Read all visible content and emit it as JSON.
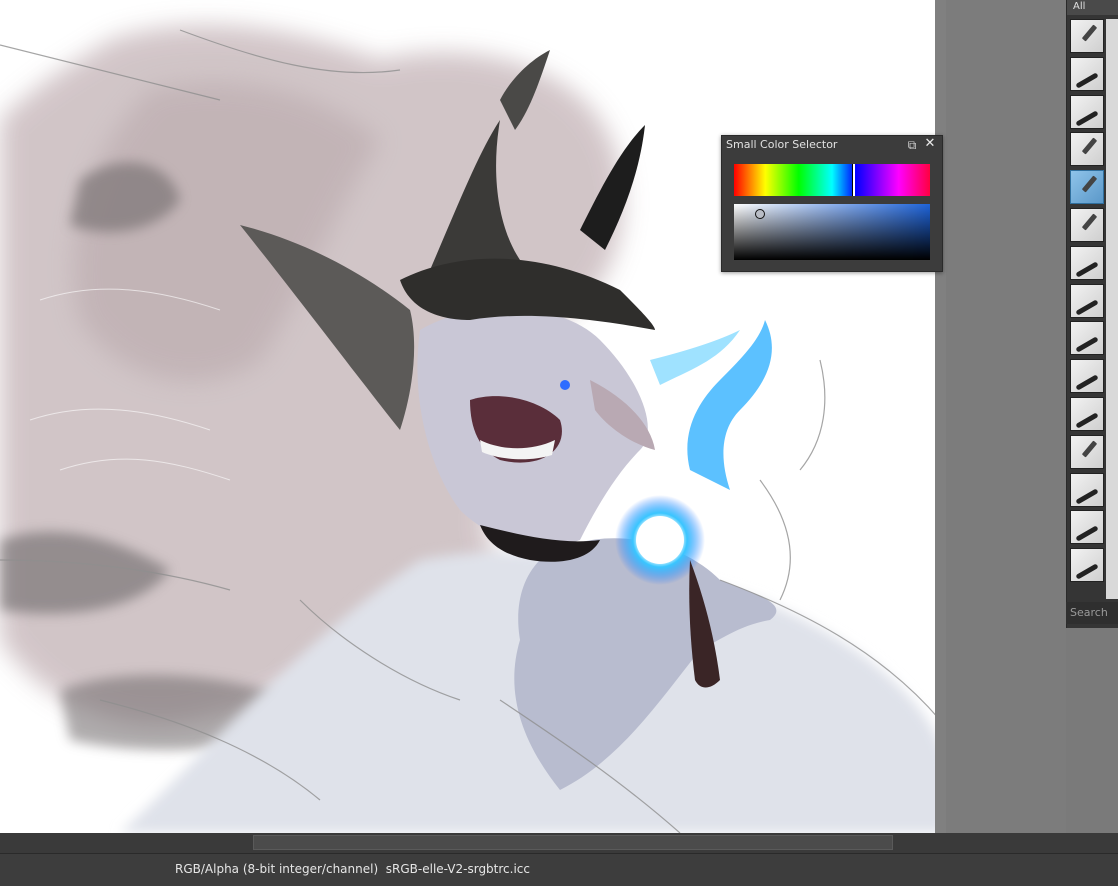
{
  "color_selector": {
    "title": "Small Color Selector",
    "float_icon": "float-icon",
    "close_icon": "close-icon"
  },
  "brush_presets": {
    "tag_filter": "All",
    "search_placeholder": "Search",
    "items": [
      {
        "icon": "eraser-brush-icon"
      },
      {
        "icon": "ink-brush-icon"
      },
      {
        "icon": "ink-pen-icon"
      },
      {
        "icon": "pencil-icon"
      },
      {
        "icon": "selected-marker-icon",
        "selected": true
      },
      {
        "icon": "fine-pen-icon"
      },
      {
        "icon": "marker-icon"
      },
      {
        "icon": "basic-brush-icon"
      },
      {
        "icon": "flat-brush-icon"
      },
      {
        "icon": "wet-brush-icon"
      },
      {
        "icon": "texture-brush-icon"
      },
      {
        "icon": "bristle-brush-icon"
      },
      {
        "icon": "watercolor-icon"
      },
      {
        "icon": "blend-brush-icon"
      },
      {
        "icon": "smudge-brush-icon"
      }
    ]
  },
  "status_bar": {
    "color_model": "RGB/Alpha (8-bit integer/channel)",
    "profile": "sRGB-elle-V2-srgbtrc.icc"
  }
}
